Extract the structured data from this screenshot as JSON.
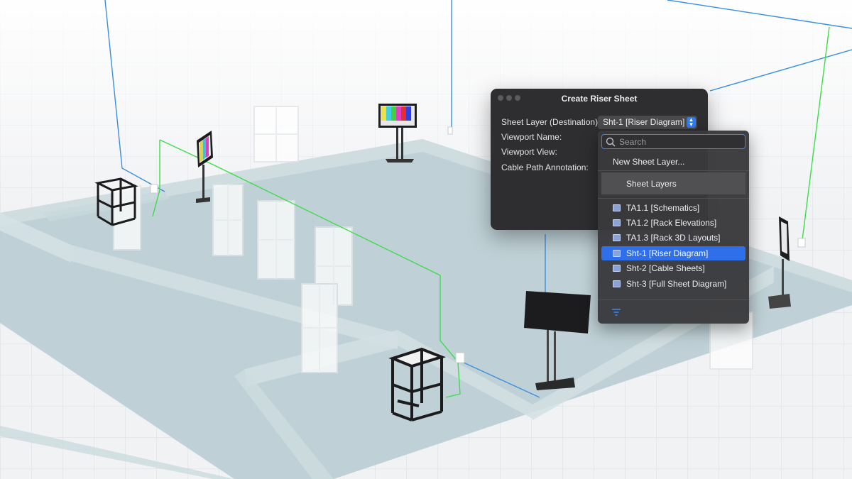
{
  "dialog": {
    "title": "Create Riser Sheet",
    "fields": [
      {
        "label": "Sheet Layer (Destination):"
      },
      {
        "label": "Viewport Name:"
      },
      {
        "label": "Viewport View:"
      },
      {
        "label": "Cable Path Annotation:"
      }
    ],
    "sheet_layer_value": "Sht-1 [Riser Diagram]"
  },
  "menu": {
    "search_placeholder": "Search",
    "new_sheet_layer": "New Sheet Layer...",
    "section_label": "Sheet Layers",
    "items": [
      {
        "label": "TA1.1 [Schematics]",
        "selected": false
      },
      {
        "label": "TA1.2 [Rack Elevations]",
        "selected": false
      },
      {
        "label": "TA1.3 [Rack 3D Layouts]",
        "selected": false
      },
      {
        "label": "Sht-1 [Riser Diagram]",
        "selected": true
      },
      {
        "label": "Sht-2 [Cable Sheets]",
        "selected": false
      },
      {
        "label": "Sht-3 [Full Sheet Diagram]",
        "selected": false
      }
    ]
  },
  "colors": {
    "accent": "#2f6fea",
    "cable_blue": "#3a8fe0",
    "cable_green": "#3ddc4a"
  },
  "icons": [
    "search-icon",
    "layer-icon",
    "filter-icon",
    "chevron-updown-icon"
  ]
}
